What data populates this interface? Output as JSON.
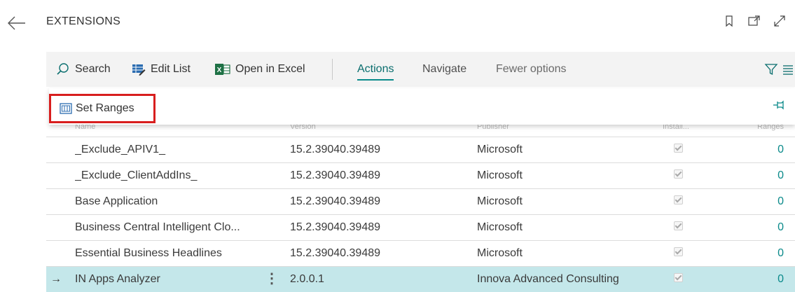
{
  "page": {
    "title": "EXTENSIONS"
  },
  "icons": {
    "back": "arrow-left-icon",
    "bookmark": "bookmark-icon",
    "open_new_window": "open-in-new-window-icon",
    "expand": "expand-icon",
    "search": "search-icon",
    "edit_list": "edit-list-icon",
    "excel": "excel-icon",
    "filter": "filter-icon",
    "list_view": "list-view-icon",
    "set_ranges": "set-ranges-icon",
    "pin": "pin-icon"
  },
  "toolbar": {
    "search_label": "Search",
    "edit_list_label": "Edit List",
    "open_excel_label": "Open in Excel",
    "tabs": [
      {
        "label": "Actions",
        "active": true
      },
      {
        "label": "Navigate",
        "active": false
      },
      {
        "label": "Fewer options",
        "active": false
      }
    ]
  },
  "actions_menu": {
    "items": [
      {
        "label": "Set Ranges",
        "highlighted": true
      }
    ]
  },
  "table": {
    "columns": [
      "Name",
      "Version",
      "Publisher",
      "Install...",
      "Ranges"
    ],
    "rows": [
      {
        "name": "_Exclude_APIV1_",
        "version": "15.2.39040.39489",
        "publisher": "Microsoft",
        "installed": true,
        "ranges": "0",
        "selected": false
      },
      {
        "name": "_Exclude_ClientAddIns_",
        "version": "15.2.39040.39489",
        "publisher": "Microsoft",
        "installed": true,
        "ranges": "0",
        "selected": false
      },
      {
        "name": "Base Application",
        "version": "15.2.39040.39489",
        "publisher": "Microsoft",
        "installed": true,
        "ranges": "0",
        "selected": false
      },
      {
        "name": "Business Central Intelligent Clo...",
        "version": "15.2.39040.39489",
        "publisher": "Microsoft",
        "installed": true,
        "ranges": "0",
        "selected": false
      },
      {
        "name": "Essential Business Headlines",
        "version": "15.2.39040.39489",
        "publisher": "Microsoft",
        "installed": true,
        "ranges": "0",
        "selected": false
      },
      {
        "name": "IN Apps Analyzer",
        "version": "2.0.0.1",
        "publisher": "Innova Advanced Consulting",
        "installed": true,
        "ranges": "0",
        "selected": true
      }
    ]
  },
  "colors": {
    "accent": "#0a8a8a",
    "selected_row": "#c4e7ea",
    "toolbar_bg": "#f3f3f3",
    "highlight_border": "#d81e1e",
    "excel_green": "#1e7145"
  }
}
